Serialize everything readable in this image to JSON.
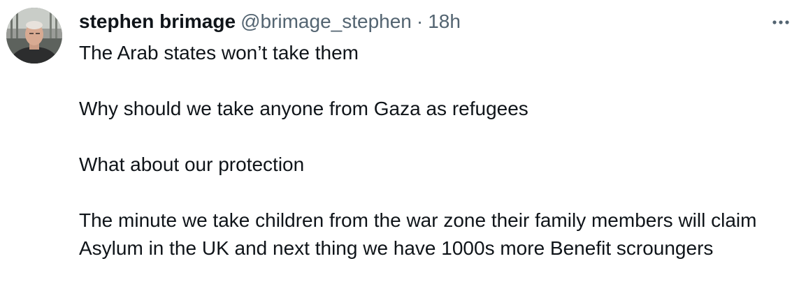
{
  "tweet": {
    "author": {
      "display_name": "stephen brimage",
      "handle": "@brimage_stephen",
      "avatar_icon": "profile-photo"
    },
    "separator": "·",
    "time": "18h",
    "more_icon": "more-horizontal-icon",
    "paragraphs": [
      "The Arab states won’t take them",
      "Why should we take anyone from Gaza as refugees",
      "What about our protection",
      "The minute we take children from the war zone their family members will claim Asylum in the UK and next thing we have 1000s more Benefit scroungers"
    ]
  },
  "colors": {
    "text_primary": "#0f1419",
    "text_secondary": "#536471",
    "background": "#ffffff"
  }
}
